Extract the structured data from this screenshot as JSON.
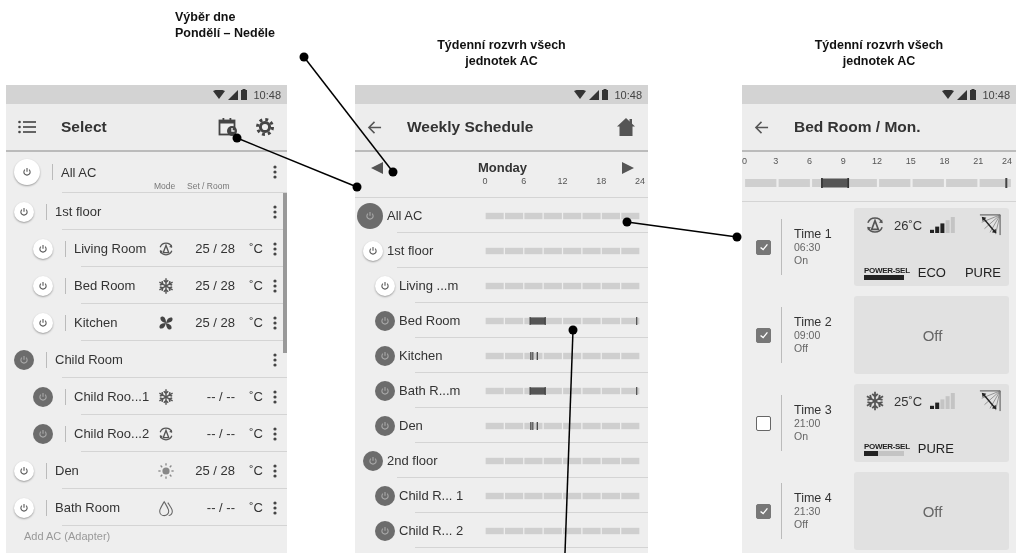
{
  "captions": [
    {
      "lines": [
        "Výběr dne",
        "Pondělí – Neděle"
      ]
    },
    {
      "lines": [
        "Týdenní rozvrh všech",
        "jednotek AC"
      ]
    },
    {
      "lines": [
        "Týdenní rozvrh všech",
        "jednotek AC"
      ]
    }
  ],
  "select_screen": {
    "status_time": "10:48",
    "title": "Select",
    "all_row": {
      "name": "All AC",
      "power_on": false,
      "mode_header": "Mode",
      "temp_header": "Set / Room"
    },
    "units": [
      {
        "name": "1st floor",
        "power_on": false,
        "children": [
          {
            "name": "Living Room",
            "power_on": false,
            "mode": {
              "kind": "auto"
            },
            "temps": "25 / 28",
            "unit": "˚C"
          },
          {
            "name": "Bed Room",
            "power_on": false,
            "mode": {
              "kind": "cool"
            },
            "temps": "25 / 28",
            "unit": "˚C"
          },
          {
            "name": "Kitchen",
            "power_on": false,
            "mode": {
              "kind": "fan"
            },
            "temps": "25 / 28",
            "unit": "˚C"
          }
        ]
      },
      {
        "name": "Child Room",
        "power_on": true,
        "children": [
          {
            "name": "Child Roo...1",
            "power_on": true,
            "mode": {
              "kind": "cool"
            },
            "temps": "-- / --",
            "unit": "˚C"
          },
          {
            "name": "Child Roo...2",
            "power_on": true,
            "mode": {
              "kind": "auto"
            },
            "temps": "-- / --",
            "unit": "˚C"
          }
        ]
      },
      {
        "name": "Den",
        "power_on": false,
        "mode": {
          "kind": "heat"
        },
        "temps": "25 / 28",
        "unit": "˚C"
      },
      {
        "name": "Bath Room",
        "power_on": false,
        "mode": {
          "kind": "dry"
        },
        "temps": "-- / --",
        "unit": "˚C"
      }
    ],
    "add_label": "Add AC (Adapter)"
  },
  "schedule_screen": {
    "status_time": "10:48",
    "title": "Weekly Schedule",
    "day": "Monday",
    "axis": [
      "0",
      "6",
      "12",
      "18",
      "24"
    ],
    "all_row": {
      "name": "All AC",
      "power_on": true
    },
    "units": [
      {
        "name": "1st floor",
        "power_on": false,
        "children": [
          {
            "name": "Living ...m",
            "power_on": false
          },
          {
            "name": "Bed Room",
            "power_on": true,
            "schedule": {
              "kind": "block_and_tick"
            }
          },
          {
            "name": "Kitchen",
            "power_on": true,
            "schedule": {
              "kind": "triple_tick"
            }
          },
          {
            "name": "Bath R...m",
            "power_on": true,
            "schedule": {
              "kind": "block_and_tick"
            }
          },
          {
            "name": "Den",
            "power_on": true,
            "schedule": {
              "kind": "triple_tick"
            }
          }
        ]
      },
      {
        "name": "2nd floor",
        "power_on": true,
        "children": [
          {
            "name": "Child R... 1",
            "power_on": true
          },
          {
            "name": "Child R... 2",
            "power_on": true
          }
        ]
      }
    ]
  },
  "detail_screen": {
    "status_time": "10:48",
    "title": "Bed Room / Mon.",
    "axis": [
      "0",
      "3",
      "6",
      "9",
      "12",
      "15",
      "18",
      "21",
      "24"
    ],
    "schedule": {
      "kind": "block_and_tick"
    },
    "timers": [
      {
        "checked": true,
        "label": "Time 1",
        "time": "06:30",
        "state": "On",
        "card": {
          "kind": "settings",
          "mode": {
            "kind": "auto"
          },
          "temp": "26˚C",
          "fan": {
            "level": 0.6
          },
          "power_sel": {
            "label": "POWER-SEL",
            "level": 1
          },
          "tags": [
            "ECO",
            "PURE"
          ]
        }
      },
      {
        "checked": true,
        "label": "Time 2",
        "time": "09:00",
        "state": "Off",
        "card": {
          "kind": "off",
          "text": "Off"
        }
      },
      {
        "checked": false,
        "label": "Time 3",
        "time": "21:00",
        "state": "On",
        "card": {
          "kind": "settings",
          "mode": {
            "kind": "cool"
          },
          "temp": "25˚C",
          "fan": {
            "level": 0.4
          },
          "power_sel": {
            "label": "POWER-SEL",
            "level": 0.34
          },
          "tags": [
            "PURE"
          ]
        }
      },
      {
        "checked": true,
        "label": "Time 4",
        "time": "21:30",
        "state": "Off",
        "card": {
          "kind": "off",
          "text": "Off"
        }
      }
    ]
  }
}
